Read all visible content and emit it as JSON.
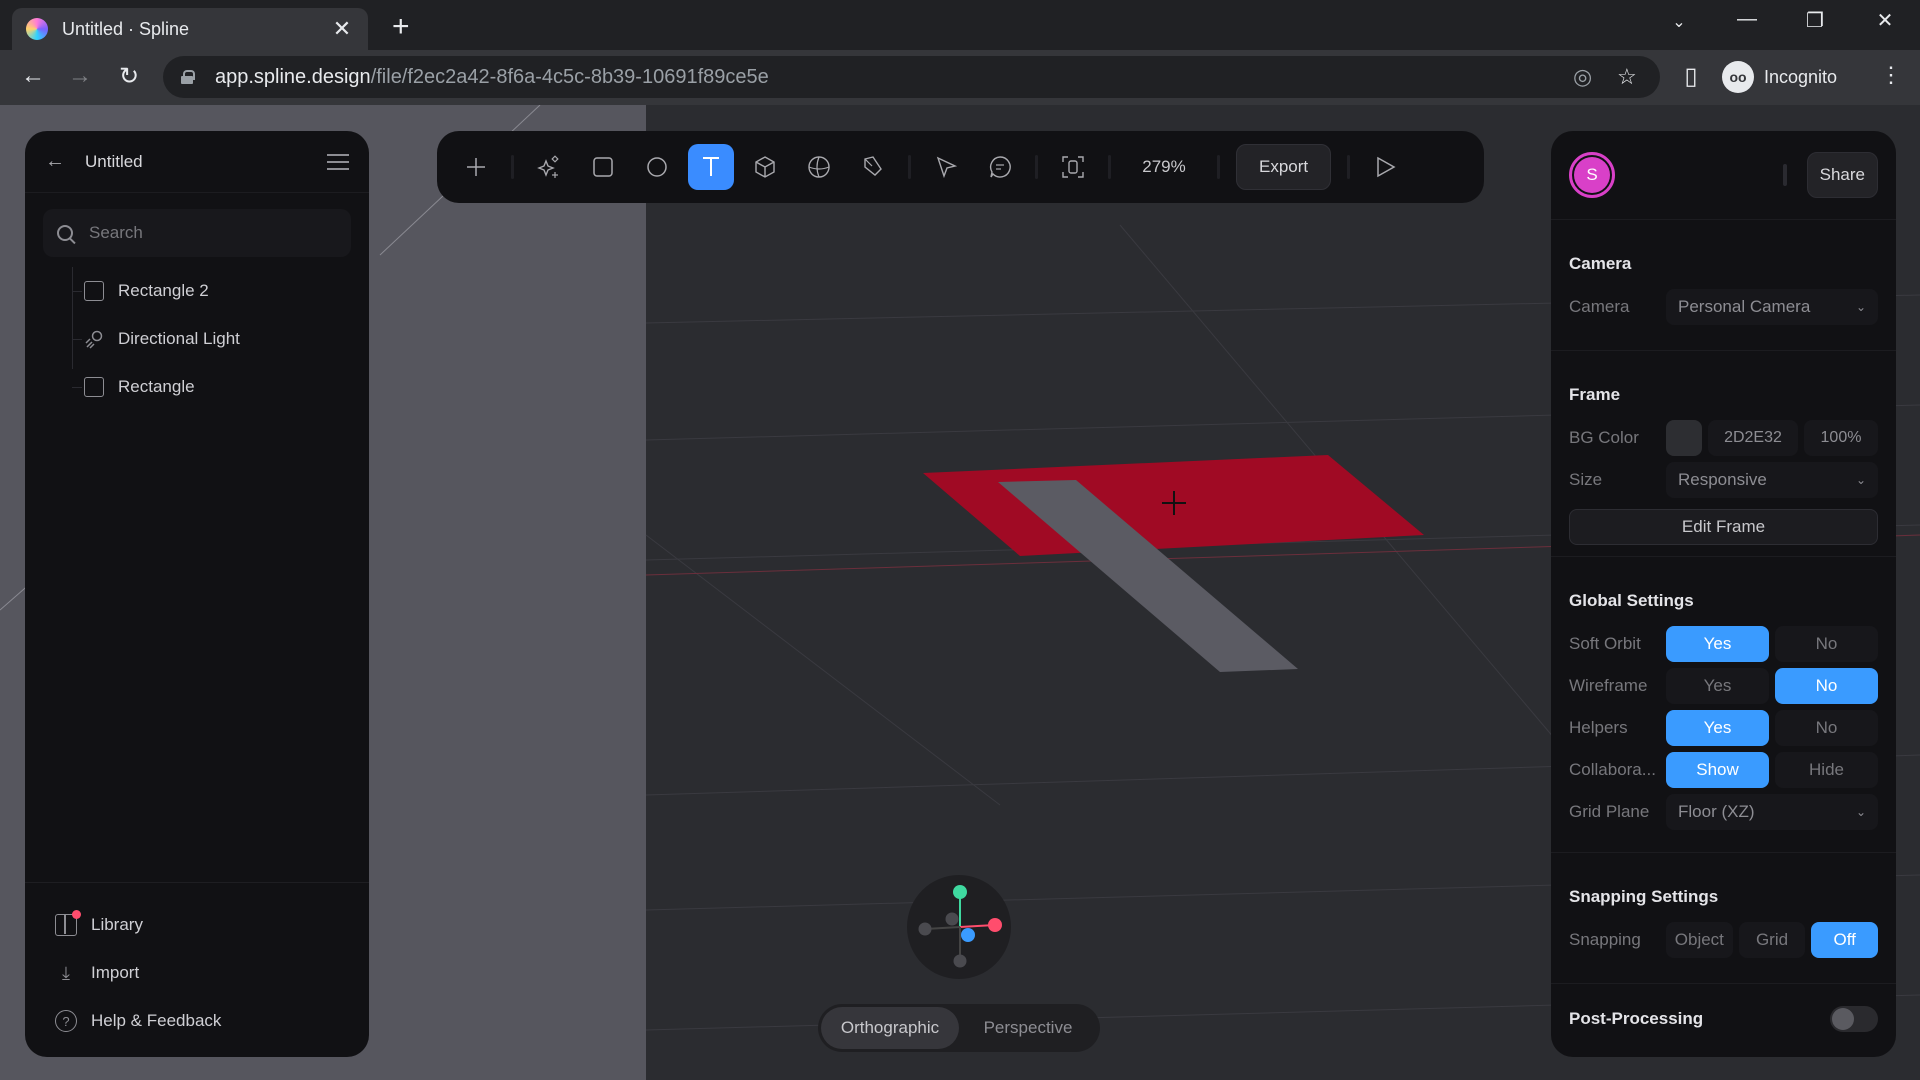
{
  "browser": {
    "tab_title": "Untitled · Spline",
    "url_host": "app.spline.design",
    "url_path": "/file/f2ec2a42-8f6a-4c5c-8b39-10691f89ce5e",
    "profile_label": "Incognito"
  },
  "left_panel": {
    "title": "Untitled",
    "search_placeholder": "Search",
    "layers": [
      {
        "label": "Rectangle 2",
        "icon": "rectangle-icon"
      },
      {
        "label": "Directional Light",
        "icon": "directional-light-icon"
      },
      {
        "label": "Rectangle",
        "icon": "rectangle-icon"
      }
    ],
    "bottom_items": [
      {
        "label": "Library",
        "icon": "library-icon",
        "has_notification": true
      },
      {
        "label": "Import",
        "icon": "import-icon"
      },
      {
        "label": "Help & Feedback",
        "icon": "help-icon"
      }
    ]
  },
  "toolbar": {
    "tools": [
      "add",
      "ai-generate",
      "rectangle",
      "ellipse",
      "text",
      "cube",
      "sphere",
      "pen",
      "pointer",
      "comment",
      "frame-focus"
    ],
    "active_tool": "text",
    "zoom": "279%",
    "export_label": "Export",
    "play": "play-icon"
  },
  "right_panel": {
    "avatar_initial": "S",
    "avatar_color": "#d940c8",
    "share_label": "Share",
    "camera": {
      "title": "Camera",
      "label": "Camera",
      "value": "Personal Camera"
    },
    "frame": {
      "title": "Frame",
      "bg_label": "BG Color",
      "bg_hex": "2D2E32",
      "bg_opacity": "100%",
      "size_label": "Size",
      "size_value": "Responsive",
      "edit_label": "Edit Frame"
    },
    "global": {
      "title": "Global Settings",
      "rows": [
        {
          "label": "Soft Orbit",
          "options": [
            "Yes",
            "No"
          ],
          "selected": "Yes"
        },
        {
          "label": "Wireframe",
          "options": [
            "Yes",
            "No"
          ],
          "selected": "No"
        },
        {
          "label": "Helpers",
          "options": [
            "Yes",
            "No"
          ],
          "selected": "Yes"
        },
        {
          "label": "Collabora...",
          "options": [
            "Show",
            "Hide"
          ],
          "selected": "Show"
        }
      ],
      "grid_plane_label": "Grid Plane",
      "grid_plane_value": "Floor (XZ)"
    },
    "snapping": {
      "title": "Snapping Settings",
      "label": "Snapping",
      "options": [
        "Object",
        "Grid",
        "Off"
      ],
      "selected": "Off"
    },
    "post_processing": {
      "title": "Post-Processing",
      "enabled": false
    }
  },
  "viewport": {
    "projection_options": [
      "Orthographic",
      "Perspective"
    ],
    "projection_selected": "Orthographic",
    "accent_color": "#3a8cff",
    "object_colors": {
      "rectangle": "#a00a24",
      "rectangle_2": "#5b5b63"
    }
  }
}
